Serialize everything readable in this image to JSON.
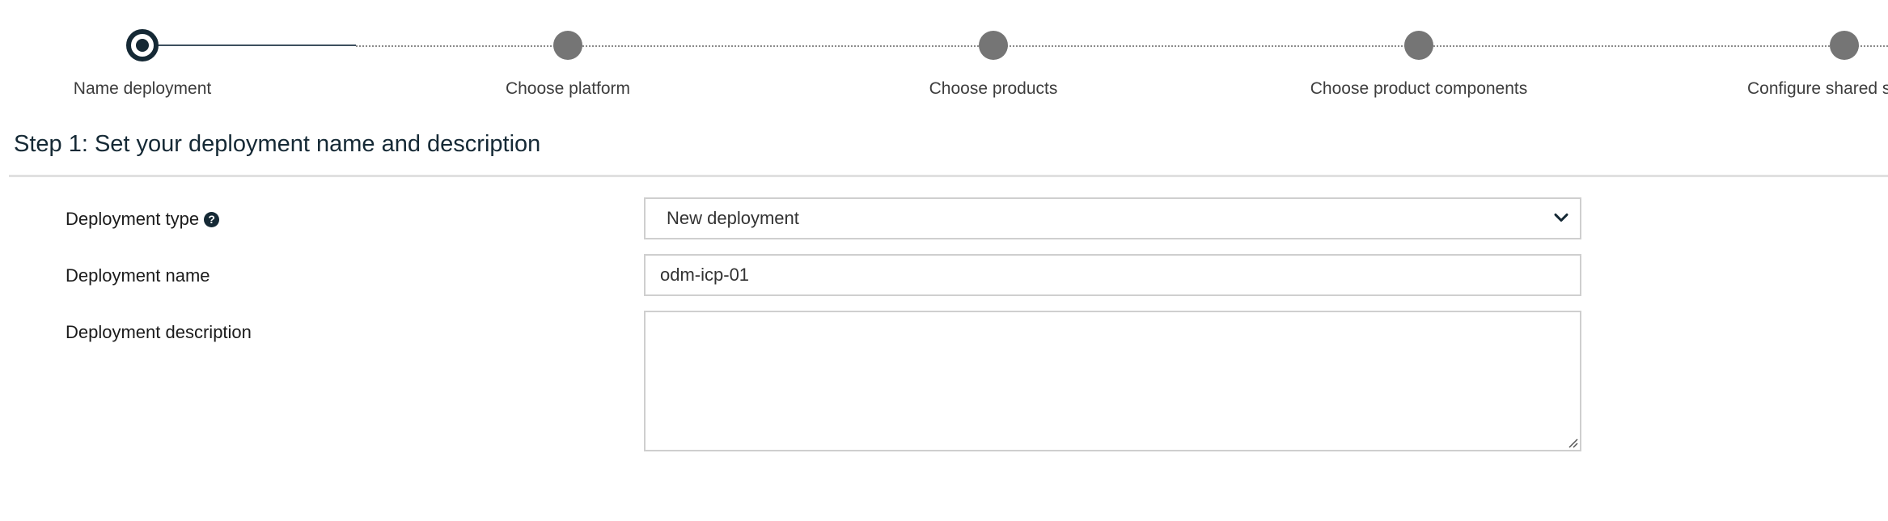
{
  "stepper": {
    "steps": [
      {
        "label": "Name deployment",
        "state": "current"
      },
      {
        "label": "Choose platform",
        "state": "pending"
      },
      {
        "label": "Choose products",
        "state": "pending"
      },
      {
        "label": "Choose product components",
        "state": "pending"
      },
      {
        "label": "Configure shared s",
        "state": "pending"
      }
    ]
  },
  "heading": "Step 1: Set your deployment name and description",
  "form": {
    "deployment_type": {
      "label": "Deployment type",
      "help_icon": "question-circle-icon",
      "value": "New deployment"
    },
    "deployment_name": {
      "label": "Deployment name",
      "value": "odm-icp-01"
    },
    "deployment_description": {
      "label": "Deployment description",
      "value": ""
    }
  },
  "colors": {
    "accent": "#152935",
    "pending_dot": "#757575",
    "border": "#cfcfcf"
  }
}
